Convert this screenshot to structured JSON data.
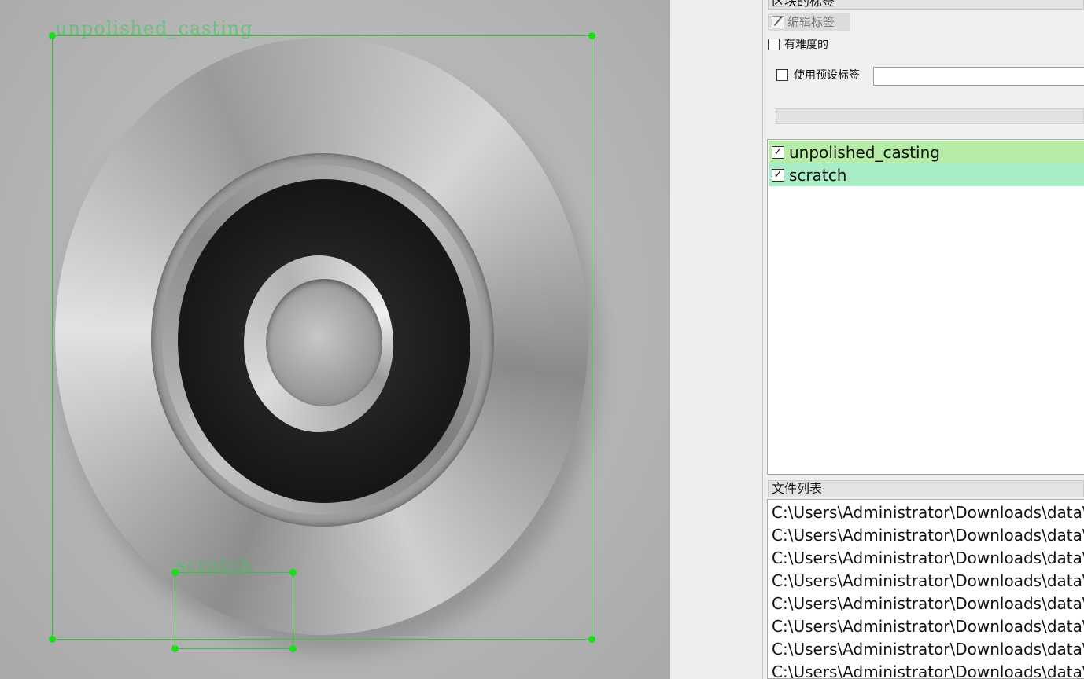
{
  "canvas": {
    "annotations": [
      {
        "label": "unpolished_casting",
        "color": "#34c734"
      },
      {
        "label": "scratch",
        "color": "#34c734"
      }
    ]
  },
  "panel": {
    "box_labels_title": "区块的标签",
    "edit_label_button": "编辑标签",
    "difficult_checkbox": {
      "label": "有难度的",
      "checked": false
    },
    "use_default_label": {
      "label": "使用预设标签",
      "checked": false,
      "value": ""
    },
    "label_list": [
      {
        "label": "unpolished_casting",
        "checked": true,
        "color": "#b6eca8"
      },
      {
        "label": "scratch",
        "checked": true,
        "color": "#a8ecc6"
      }
    ],
    "file_list_title": "文件列表",
    "files": [
      "C:\\Users\\Administrator\\Downloads\\data\\J",
      "C:\\Users\\Administrator\\Downloads\\data\\J",
      "C:\\Users\\Administrator\\Downloads\\data\\J",
      "C:\\Users\\Administrator\\Downloads\\data\\J",
      "C:\\Users\\Administrator\\Downloads\\data\\J",
      "C:\\Users\\Administrator\\Downloads\\data\\J",
      "C:\\Users\\Administrator\\Downloads\\data\\J",
      "C:\\Users\\Administrator\\Downloads\\data\\J"
    ]
  }
}
